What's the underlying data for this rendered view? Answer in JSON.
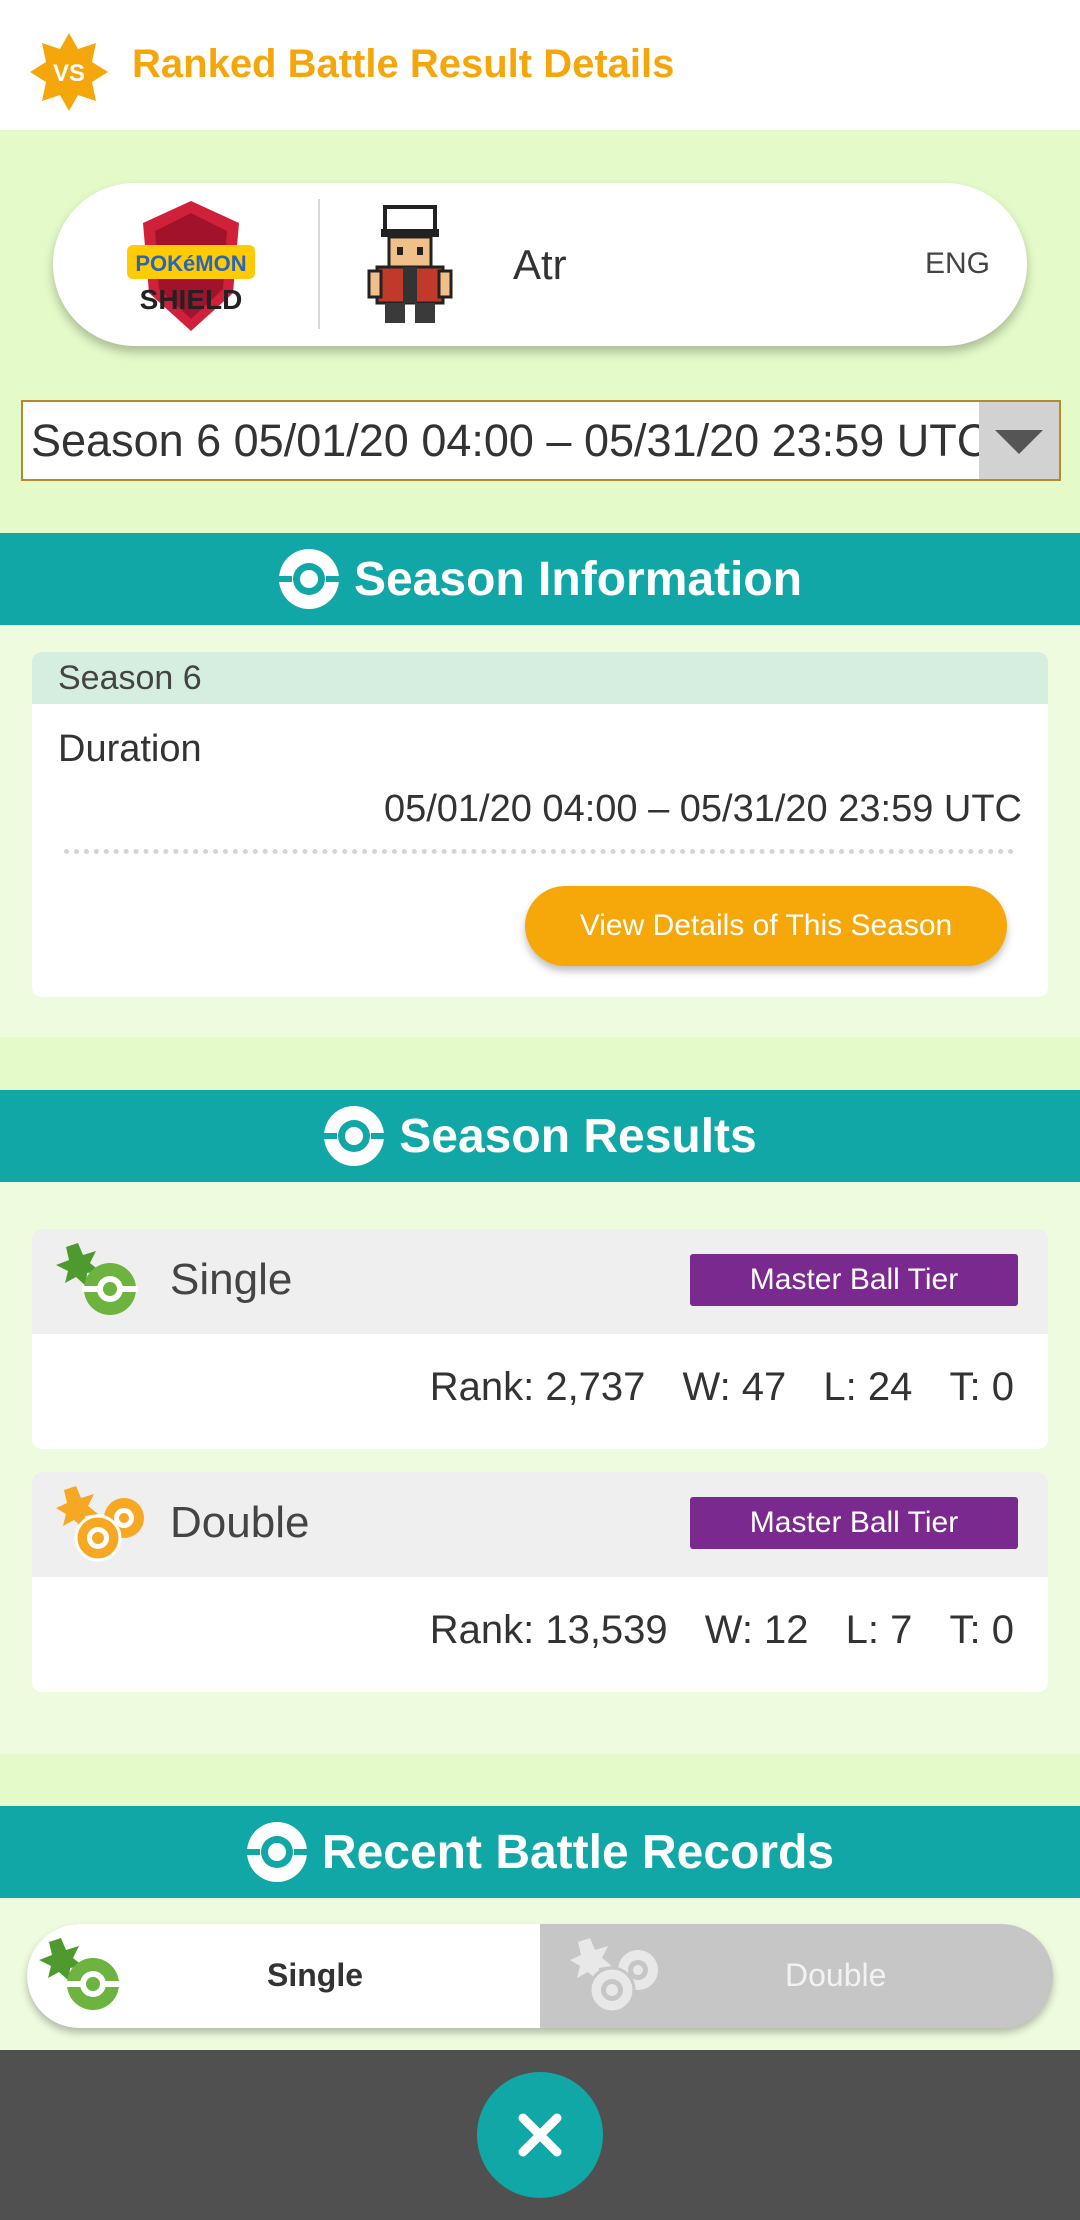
{
  "header": {
    "title": "Ranked Battle Result Details",
    "badge": "VS"
  },
  "player": {
    "game_logo_top": "POKéMON",
    "game_logo_bottom": "SHIELD",
    "name": "Atr",
    "language": "ENG"
  },
  "season_select": {
    "value": "Season 6 05/01/20 04:00 – 05/31/20 23:59 UTC"
  },
  "season_info": {
    "title": "Season Information",
    "season_label": "Season 6",
    "duration_label": "Duration",
    "duration_value": "05/01/20 04:00 – 05/31/20 23:59 UTC",
    "details_button": "View Details of This Season"
  },
  "season_results": {
    "title": "Season Results",
    "single": {
      "label": "Single",
      "tier": "Master Ball Tier",
      "rank": "Rank: 2,737",
      "wins": "W: 47",
      "losses": "L: 24",
      "ties": "T: 0"
    },
    "double": {
      "label": "Double",
      "tier": "Master Ball Tier",
      "rank": "Rank: 13,539",
      "wins": "W: 12",
      "losses": "L: 7",
      "ties": "T: 0"
    }
  },
  "recent": {
    "title": "Recent Battle Records",
    "tab_single": "Single",
    "tab_double": "Double"
  },
  "colors": {
    "accent_orange": "#f5a60b",
    "section_teal": "#12a7a7",
    "tier_purple": "#7a2a8f",
    "single_green": "#6cb33f",
    "double_orange": "#f7a823",
    "page_bg": "#e4fac8"
  },
  "icons": {
    "header": "vs-star-icon",
    "section": "pokeball-icon",
    "single": "single-battle-icon",
    "double": "double-battle-icon",
    "close": "close-icon",
    "select": "dropdown-arrow-icon"
  }
}
